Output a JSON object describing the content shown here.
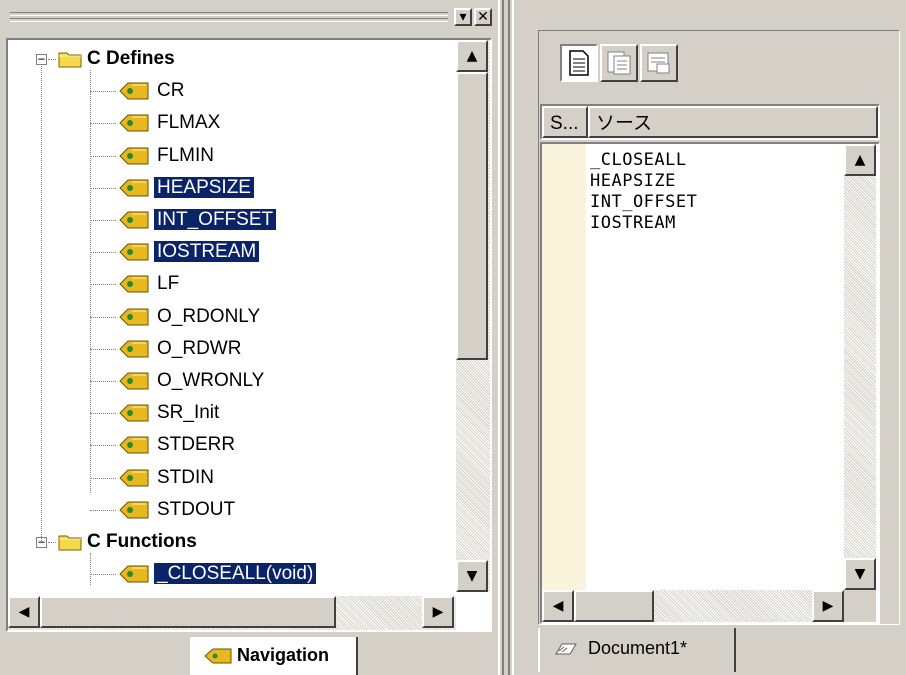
{
  "left_panel": {
    "title_buttons": [
      "▾",
      "✕"
    ],
    "tree": [
      {
        "type": "folder",
        "label": "C Defines",
        "expanded": true,
        "selected": false
      },
      {
        "type": "item",
        "label": "CR",
        "selected": false
      },
      {
        "type": "item",
        "label": "FLMAX",
        "selected": false
      },
      {
        "type": "item",
        "label": "FLMIN",
        "selected": false
      },
      {
        "type": "item",
        "label": "HEAPSIZE",
        "selected": true
      },
      {
        "type": "item",
        "label": "INT_OFFSET",
        "selected": true
      },
      {
        "type": "item",
        "label": "IOSTREAM",
        "selected": true
      },
      {
        "type": "item",
        "label": "LF",
        "selected": false
      },
      {
        "type": "item",
        "label": "O_RDONLY",
        "selected": false
      },
      {
        "type": "item",
        "label": "O_RDWR",
        "selected": false
      },
      {
        "type": "item",
        "label": "O_WRONLY",
        "selected": false
      },
      {
        "type": "item",
        "label": "SR_Init",
        "selected": false
      },
      {
        "type": "item",
        "label": "STDERR",
        "selected": false
      },
      {
        "type": "item",
        "label": "STDIN",
        "selected": false
      },
      {
        "type": "item",
        "label": "STDOUT",
        "selected": false
      },
      {
        "type": "folder",
        "label": "C Functions",
        "expanded": true,
        "selected": false
      },
      {
        "type": "item",
        "label": "_CLOSEALL(void)",
        "selected": true
      }
    ],
    "tab_label": "Navigation",
    "scroll_arrows": {
      "up": "▲",
      "down": "▼",
      "left": "◀",
      "right": "▶"
    }
  },
  "right_panel": {
    "toolbar_icons": [
      "document-icon",
      "function-icon",
      "define-icon"
    ],
    "columns": [
      "S...",
      "ソース"
    ],
    "source_lines": [
      "_CLOSEALL",
      "HEAPSIZE",
      "INT_OFFSET",
      "IOSTREAM"
    ],
    "tab_label": "Document1*"
  },
  "colors": {
    "selection_bg": "#0a246a",
    "selection_fg": "#ffffff",
    "face": "#d4d0c8",
    "gutter": "#fbf4dc",
    "tag_icon": "#e8b820"
  }
}
